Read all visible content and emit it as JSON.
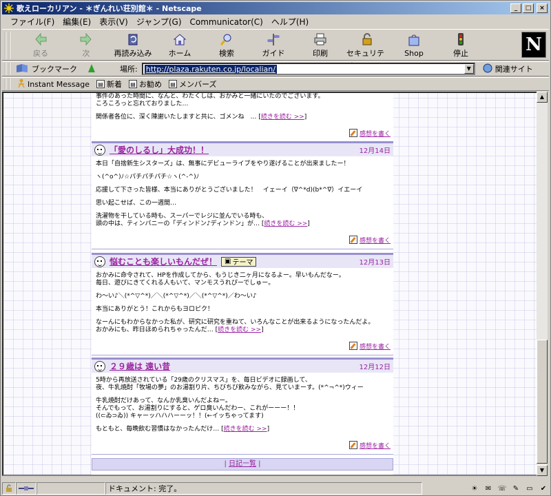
{
  "window": {
    "title": "歌えローカリアン - ＊ぎんれい荘別館＊ - Netscape"
  },
  "menu": [
    "ファイル(F)",
    "編集(E)",
    "表示(V)",
    "ジャンプ(G)",
    "Communicator(C)",
    "ヘルプ(H)"
  ],
  "nav_buttons": [
    {
      "label": "戻る",
      "icon": "back-arrow-icon",
      "disabled": true
    },
    {
      "label": "次",
      "icon": "forward-arrow-icon",
      "disabled": true
    },
    {
      "label": "再読み込み",
      "icon": "reload-icon"
    },
    {
      "label": "ホーム",
      "icon": "home-icon"
    },
    {
      "label": "検索",
      "icon": "search-icon"
    },
    {
      "label": "ガイド",
      "icon": "guide-icon"
    },
    {
      "label": "印刷",
      "icon": "print-icon"
    },
    {
      "label": "セキュリティ",
      "icon": "security-lock-icon"
    },
    {
      "label": "Shop",
      "icon": "shop-icon"
    },
    {
      "label": "停止",
      "icon": "stop-icon"
    }
  ],
  "location": {
    "bookmarks_label": "ブックマーク",
    "label": "場所:",
    "url": "http://plaza.rakuten.co.jp/localian/",
    "related_label": "関連サイト"
  },
  "personal_toolbar": [
    "Instant Message",
    "新着",
    "お勧め",
    "メンバーズ"
  ],
  "posts": [
    {
      "title": "",
      "date": "",
      "body": [
        "事件のあった時間に、なんと、わたくしは、おかみと一緒にいたのでございます。",
        "ころころっと忘れておりました…",
        "関係者各位に、深く陳謝いたしますと共に、ゴメンね　…"
      ],
      "more": "続きを読む >>",
      "comment": "感想を書く"
    },
    {
      "title": "「愛のしるし」大成功！！",
      "date": "12月14日",
      "body": [
        "本日「自捨新生シスターズ」は、無事にデビューライブをやり遂げることが出来ましたー！",
        "ヽ(^o^)ﾉ☆パチパチパチ☆ヽ(^-^)ﾉ",
        "応援して下さった皆様、本当にありがとうございました！　イェーイ（∇^*d)(b*^∇）イエーイ",
        "思い起こせば、この一週間…",
        "洗濯物を干している時も、スーパーでレジに並んでいる時も、",
        "頭の中は、ティンパニーの「ディンドン♪ディンドン」が…"
      ],
      "more": "続きを読む >>",
      "comment": "感想を書く"
    },
    {
      "title": "悩むことも楽しいもんだぜ！",
      "theme": "テーマ",
      "date": "12月13日",
      "body": [
        "おかみに命令されて、HPを作成してから、もうじき二ヶ月になるよー。早いもんだなー。",
        "毎日、遊びにきてくれる人もいて、マンモスうれぴーでしゅー。",
        "わ～い♪＼(*^▽^*)／＼(*^▽^*)／＼(*^▽^*)／わ～い♪",
        "本当にありがとう！これからもヨロピク！",
        "なーんにもわからなかった私が、研究に研究を重ねて、いろんなことが出来るようになったんだよ。",
        "おかみにも、昨日ほめられちゃったんだ…"
      ],
      "more": "続きを読む >>",
      "comment": "感想を書く"
    },
    {
      "title": "２９歳は 遠い昔",
      "date": "12月12日",
      "body": [
        "5時から再放送されている「29歳のクリスマス」を、毎日ビデオに録画して、",
        "夜、牛乳焼酎「牧場の夢」のお湯割り片、ちびちび飲みながら、見ていまーす。(*^¬^*)ウィー",
        "牛乳焼酎だけあって、なんか乳臭いんだよねー。",
        "そんでもって、お湯割りにすると、ゲロ臭いんだわー、これがーーー！！",
        "((⊂ゐ⊃ゐ)) キャーッハハハーーッ！！(←イッちゃってます)",
        "もともと、毎晩飲む習慣はなかったんだけ…"
      ],
      "more": "続きを読む >>",
      "comment": "感想を書く"
    }
  ],
  "footer": {
    "link": "日記一覧"
  },
  "status": {
    "text": "ドキュメント: 完了。"
  }
}
